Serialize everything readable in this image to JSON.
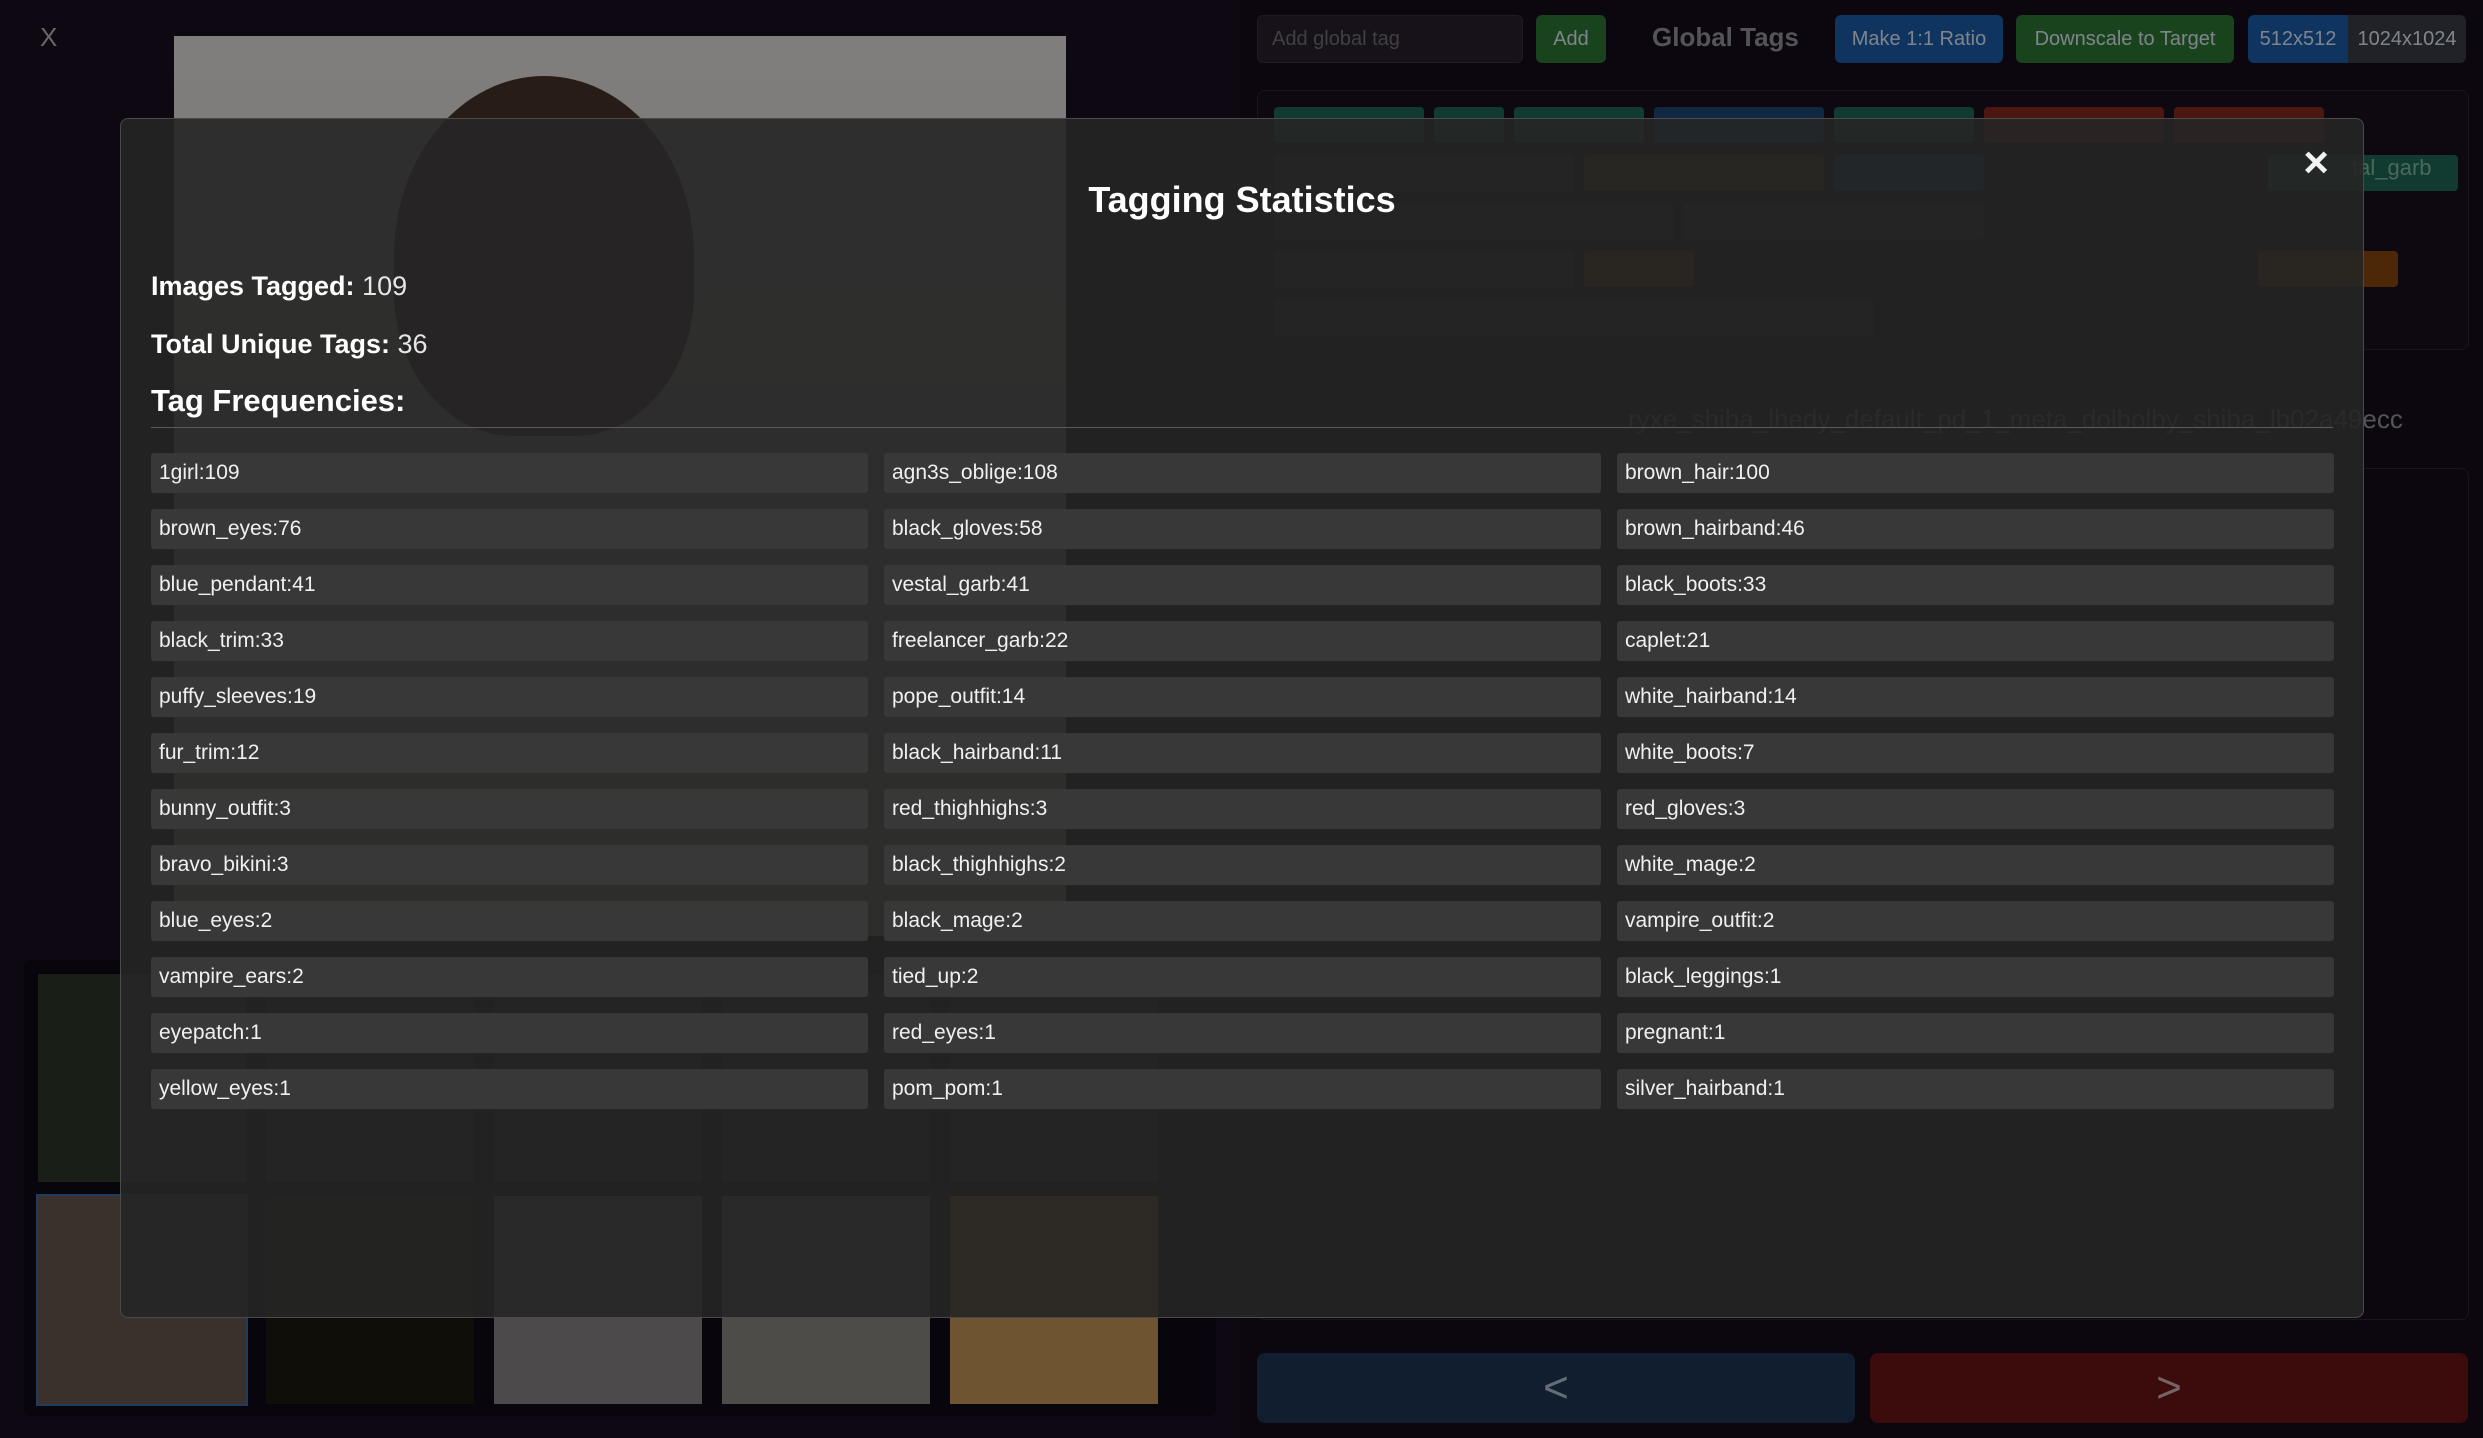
{
  "app": {
    "close_label": "X",
    "global_tag_placeholder": "Add global tag",
    "add_label": "Add",
    "global_tags_title": "Global Tags",
    "ratio_label": "Make 1:1 Ratio",
    "downscale_label": "Downscale to Target",
    "size_options": [
      "512x512",
      "1024x1024"
    ],
    "size_selected": "512x512",
    "visible_tag_fragment": "tal_garb",
    "hash_fragment": "ryxe_shiba_lhedy_default_pd_1_meta_dolbolby_shiba_lb02a49ecc",
    "prev_label": "<",
    "next_label": ">"
  },
  "modal": {
    "close_icon": "×",
    "title": "Tagging Statistics",
    "images_tagged_label": "Images Tagged:",
    "images_tagged_value": "109",
    "unique_tags_label": "Total Unique Tags:",
    "unique_tags_value": "36",
    "frequencies_title": "Tag Frequencies:"
  },
  "tag_frequencies": [
    {
      "tag": "1girl",
      "count": 109
    },
    {
      "tag": "agn3s_oblige",
      "count": 108
    },
    {
      "tag": "brown_hair",
      "count": 100
    },
    {
      "tag": "brown_eyes",
      "count": 76
    },
    {
      "tag": "black_gloves",
      "count": 58
    },
    {
      "tag": "brown_hairband",
      "count": 46
    },
    {
      "tag": "blue_pendant",
      "count": 41
    },
    {
      "tag": "vestal_garb",
      "count": 41
    },
    {
      "tag": "black_boots",
      "count": 33
    },
    {
      "tag": "black_trim",
      "count": 33
    },
    {
      "tag": "freelancer_garb",
      "count": 22
    },
    {
      "tag": "caplet",
      "count": 21
    },
    {
      "tag": "puffy_sleeves",
      "count": 19
    },
    {
      "tag": "pope_outfit",
      "count": 14
    },
    {
      "tag": "white_hairband",
      "count": 14
    },
    {
      "tag": "fur_trim",
      "count": 12
    },
    {
      "tag": "black_hairband",
      "count": 11
    },
    {
      "tag": "white_boots",
      "count": 7
    },
    {
      "tag": "bunny_outfit",
      "count": 3
    },
    {
      "tag": "red_thighhighs",
      "count": 3
    },
    {
      "tag": "red_gloves",
      "count": 3
    },
    {
      "tag": "bravo_bikini",
      "count": 3
    },
    {
      "tag": "black_thighhighs",
      "count": 2
    },
    {
      "tag": "white_mage",
      "count": 2
    },
    {
      "tag": "blue_eyes",
      "count": 2
    },
    {
      "tag": "black_mage",
      "count": 2
    },
    {
      "tag": "vampire_outfit",
      "count": 2
    },
    {
      "tag": "vampire_ears",
      "count": 2
    },
    {
      "tag": "tied_up",
      "count": 2
    },
    {
      "tag": "black_leggings",
      "count": 1
    },
    {
      "tag": "eyepatch",
      "count": 1
    },
    {
      "tag": "red_eyes",
      "count": 1
    },
    {
      "tag": "pregnant",
      "count": 1
    },
    {
      "tag": "yellow_eyes",
      "count": 1
    },
    {
      "tag": "pom_pom",
      "count": 1
    },
    {
      "tag": "silver_hairband",
      "count": 1
    }
  ],
  "colors": {
    "blue_button": "#1d5fae",
    "green_button": "#2f7b36",
    "red_nav": "#6e1414",
    "blue_nav": "#1e3858"
  }
}
